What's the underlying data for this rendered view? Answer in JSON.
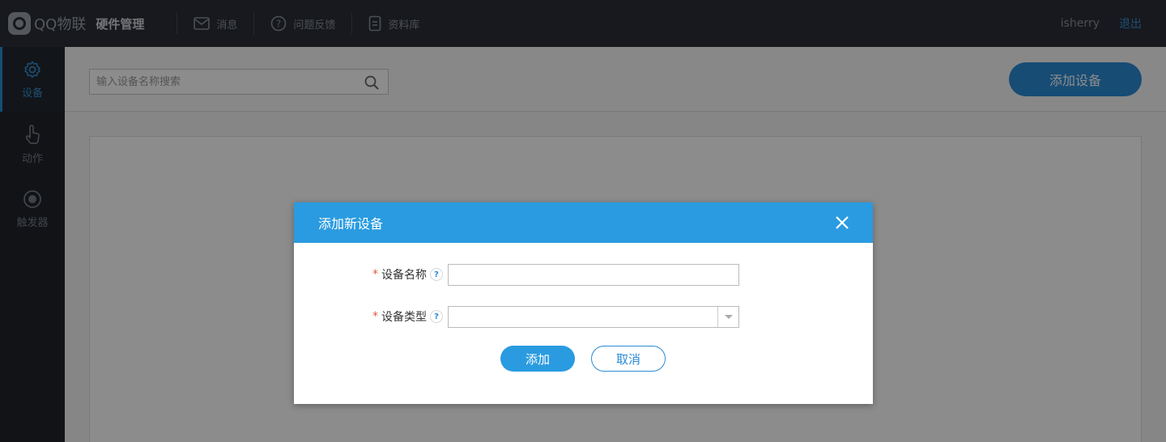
{
  "header": {
    "brand_name": "QQ物联",
    "brand_sub": "硬件管理",
    "nav": [
      {
        "label": "消息",
        "icon": "mail-icon"
      },
      {
        "label": "问题反馈",
        "icon": "question-icon"
      },
      {
        "label": "资料库",
        "icon": "document-icon"
      }
    ],
    "user_name": "isherry",
    "logout_label": "退出"
  },
  "sidebar": {
    "items": [
      {
        "label": "设备",
        "icon": "gear-icon",
        "active": true
      },
      {
        "label": "动作",
        "icon": "pointer-hand-icon",
        "active": false
      },
      {
        "label": "触发器",
        "icon": "target-icon",
        "active": false
      }
    ]
  },
  "toolbar": {
    "search_placeholder": "输入设备名称搜索",
    "add_device_label": "添加设备"
  },
  "modal": {
    "title": "添加新设备",
    "fields": [
      {
        "label": "设备名称",
        "required_mark": "*",
        "help": "?",
        "value": ""
      },
      {
        "label": "设备类型",
        "required_mark": "*",
        "help": "?",
        "value": ""
      }
    ],
    "submit_label": "添加",
    "cancel_label": "取消"
  },
  "colors": {
    "accent": "#2a9be0",
    "topbar": "#2a2f37",
    "sidebar": "#1f242b"
  }
}
